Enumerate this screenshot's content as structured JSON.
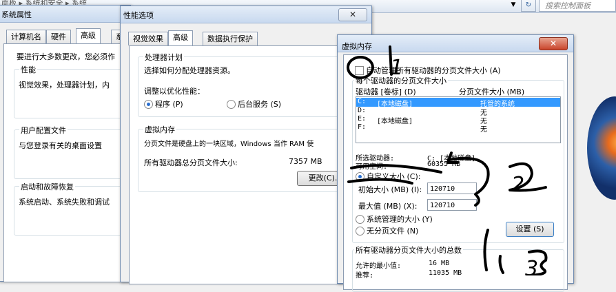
{
  "explorer": {
    "breadcrumb": "面板 ▸ 系统和安全 ▸ 系统",
    "search_placeholder": "搜索控制面板"
  },
  "sysprops": {
    "title": "系统属性",
    "tabs": [
      "计算机名",
      "硬件",
      "高级",
      "系"
    ],
    "intro": "要进行大多数更改，您必须作",
    "perf_title": "性能",
    "perf_desc": "视觉效果，处理器计划，内",
    "profile_title": "用户配置文件",
    "profile_desc": "与您登录有关的桌面设置",
    "startup_title": "启动和故障恢复",
    "startup_desc": "系统启动、系统失败和调试"
  },
  "perfopts": {
    "title": "性能选项",
    "close": "✕",
    "tabs": [
      "视觉效果",
      "高级",
      "数据执行保护"
    ],
    "cpu_title": "处理器计划",
    "cpu_desc": "选择如何分配处理器资源。",
    "optimize_label": "调整以优化性能：",
    "opt_program": "程序 (P)",
    "opt_background": "后台服务 (S)",
    "vm_title": "虚拟内存",
    "vm_desc": "分页文件是硬盘上的一块区域，Windows 当作 RAM 使",
    "vm_total_label": "所有驱动器总分页文件大小:",
    "vm_total_value": "7357 MB",
    "change_button": "更改(C)..."
  },
  "vmem": {
    "title": "虚拟内存",
    "close": "✕",
    "auto_manage": "自动管理所有驱动器的分页文件大小 (A)",
    "per_drive": "每个驱动器的分页文件大小",
    "col_drive": "驱动器 [卷标] (D)",
    "col_size": "分页文件大小 (MB)",
    "drives": [
      {
        "drive": "C:",
        "label": "[本地磁盘]",
        "size": "托管的系统",
        "selected": true
      },
      {
        "drive": "D:",
        "label": "",
        "size": "无",
        "selected": false
      },
      {
        "drive": "E:",
        "label": "[本地磁盘]",
        "size": "无",
        "selected": false
      },
      {
        "drive": "F:",
        "label": "",
        "size": "无",
        "selected": false
      }
    ],
    "selected_drive_label": "所选驱动器:",
    "selected_drive_value": "C:  [本地磁盘]",
    "free_space_label": "可用空间:",
    "free_space_value": "60355 MB",
    "custom_size": "自定义大小 (C):",
    "initial_label": "初始大小 (MB) (I):",
    "initial_value": "120710",
    "max_label": "最大值 (MB) (X):",
    "max_value": "120710",
    "system_managed": "系统管理的大小 (Y)",
    "no_paging": "无分页文件 (N)",
    "set_button": "设置 (S)",
    "total_section": "所有驱动器分页文件大小的总数",
    "min_allowed_label": "允许的最小值:",
    "min_allowed_value": "16 MB",
    "recommended_label": "推荐:",
    "recommended_value": "11035 MB"
  },
  "annotations": {
    "step1": "1",
    "step2": "2",
    "step3": "3"
  }
}
